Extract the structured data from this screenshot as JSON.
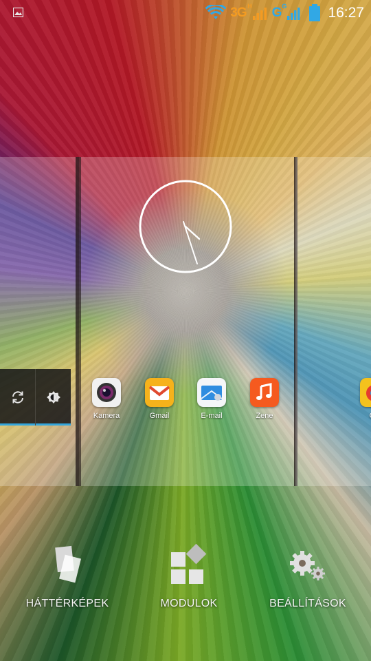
{
  "status_bar": {
    "network_primary": "3G",
    "network_primary_sup": "H",
    "network_secondary": "G",
    "network_secondary_sup": "G",
    "time": "16:27",
    "accent_orange": "#f39b22",
    "accent_blue": "#31a8e5",
    "icons": [
      "gallery-notification-icon",
      "wifi-icon",
      "signal-icon",
      "battery-icon"
    ]
  },
  "widgets": {
    "clock": {
      "type": "analog-clock"
    },
    "toggles": [
      "sync-icon",
      "brightness-icon"
    ],
    "toggle_accent": "#33a6dc"
  },
  "apps": [
    {
      "label": "Kamera",
      "icon": "camera-icon"
    },
    {
      "label": "Gmail",
      "icon": "gmail-icon"
    },
    {
      "label": "E-mail",
      "icon": "email-icon"
    },
    {
      "label": "Zene",
      "icon": "music-icon"
    },
    {
      "label": "Ga",
      "icon": "games-icon"
    }
  ],
  "overview_options": [
    {
      "label": "HÁTTÉRKÉPEK",
      "icon": "wallpapers-icon"
    },
    {
      "label": "MODULOK",
      "icon": "widgets-icon"
    },
    {
      "label": "BEÁLLÍTÁSOK",
      "icon": "settings-icon"
    }
  ]
}
